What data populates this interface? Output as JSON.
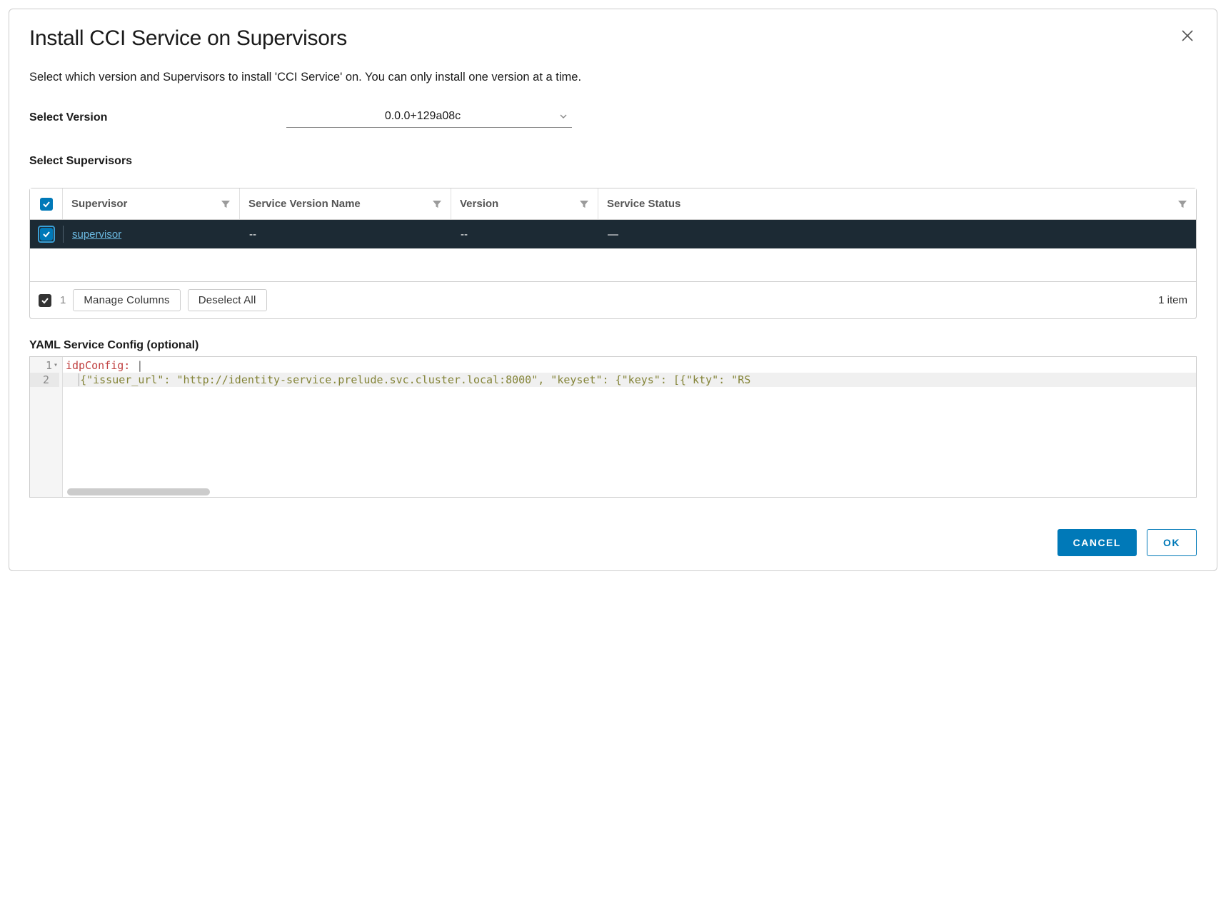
{
  "dialog": {
    "title": "Install CCI Service on Supervisors",
    "description": "Select which version and Supervisors to install 'CCI Service' on. You can only install one version at a time."
  },
  "version_field": {
    "label": "Select Version",
    "value": "0.0.0+129a08c"
  },
  "supervisors_section": {
    "label": "Select Supervisors"
  },
  "table": {
    "columns": {
      "supervisor": "Supervisor",
      "service_version_name": "Service Version Name",
      "version": "Version",
      "service_status": "Service Status"
    },
    "rows": [
      {
        "checked": true,
        "supervisor": "supervisor",
        "service_version_name": "--",
        "version": "--",
        "service_status": "—"
      }
    ],
    "footer": {
      "selected_count": "1",
      "manage_columns": "Manage Columns",
      "deselect_all": "Deselect All",
      "items": "1 item"
    }
  },
  "yaml": {
    "label": "YAML Service Config (optional)",
    "lines": {
      "line1_key": "idpConfig:",
      "line1_pipe": " |",
      "line2": "{\"issuer_url\": \"http://identity-service.prelude.svc.cluster.local:8000\", \"keyset\": {\"keys\": [{\"kty\": \"RS"
    },
    "gutter": [
      "1",
      "2"
    ]
  },
  "actions": {
    "cancel": "CANCEL",
    "ok": "OK"
  }
}
